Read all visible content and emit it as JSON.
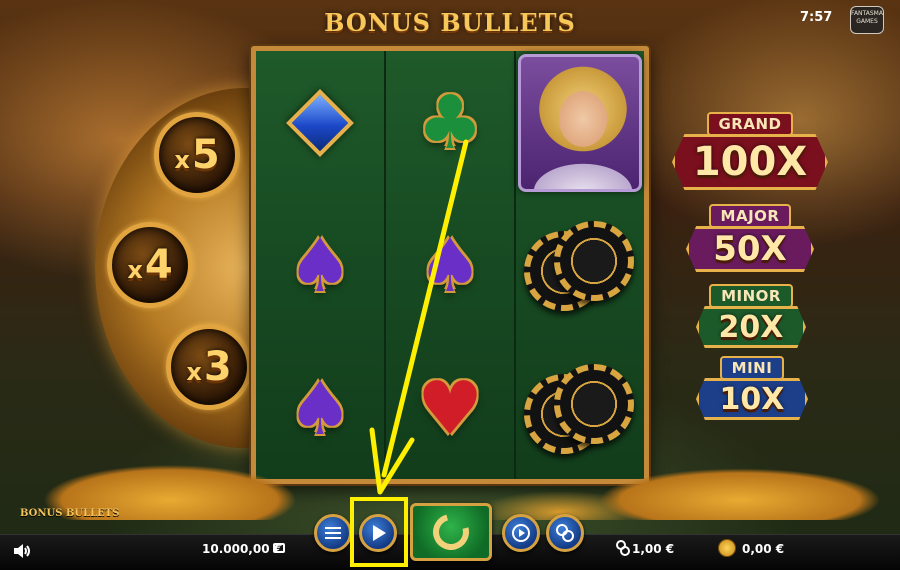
{
  "header": {
    "title": "BONUS BULLETS",
    "clock": "7:57",
    "studio_logo": "FANTASMA GAMES"
  },
  "multipliers": {
    "top": {
      "prefix": "x",
      "value": "5"
    },
    "middle": {
      "prefix": "x",
      "value": "4"
    },
    "bottom": {
      "prefix": "x",
      "value": "3"
    }
  },
  "reels": [
    [
      "diamond",
      "spade",
      "spade"
    ],
    [
      "club",
      "spade",
      "heart"
    ],
    [
      "portrait",
      "chips",
      "chips"
    ]
  ],
  "jackpots": [
    {
      "label": "GRAND",
      "value": "100X",
      "color": "#7a0f1d"
    },
    {
      "label": "MAJOR",
      "value": "50X",
      "color": "#6a1b5e"
    },
    {
      "label": "MINOR",
      "value": "20X",
      "color": "#1d5a2a"
    },
    {
      "label": "MINI",
      "value": "10X",
      "color": "#1d3f8a"
    }
  ],
  "footer": {
    "brand": "BONUS BULLETS",
    "balance": "10.000,00 €",
    "bet": "1,00 €",
    "win": "0,00 €"
  },
  "icons": {
    "sound": "speaker-icon",
    "menu": "menu-icon",
    "play": "play-icon",
    "spin": "spin-icon",
    "autoplay": "autoplay-icon",
    "bet_settings": "coins-icon"
  },
  "annotation": {
    "color": "#ffef00"
  }
}
